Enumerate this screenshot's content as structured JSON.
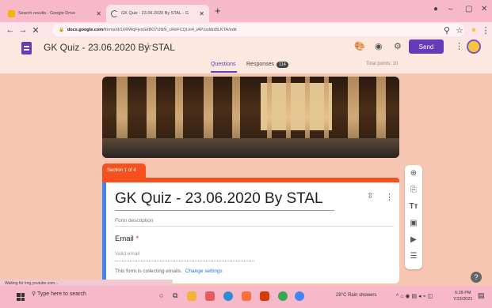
{
  "browser": {
    "tabs": [
      {
        "label": "Search results - Google Drive",
        "favicon_color": "#f4b400"
      },
      {
        "label": "GK Quiz - 23.06.2020 By STAL - G",
        "favicon_color": "#673ab7"
      }
    ],
    "new_tab": "+",
    "url_prefix": "docs.google.com",
    "url_rest": "/forms/d/1XRWqFjvxGkBO7UNN_cReFCQUo4_iAPzxddoBLKTA/edit"
  },
  "forms_header": {
    "doc_title": "GK Quiz - 23.06.2020 By STAL",
    "send_label": "Send",
    "tabs": {
      "questions": "Questions",
      "responses": "Responses",
      "responses_count": "114"
    },
    "total_points": "Total points: 10"
  },
  "section": {
    "label": "Section 1 of 4",
    "title": "GK Quiz - 23.06.2020 By STAL",
    "description_placeholder": "Form description",
    "email_label": "Email",
    "email_required_mark": "*",
    "email_placeholder": "Valid email",
    "collect_note": "This form is collecting emails.",
    "change_settings": "Change settings"
  },
  "status_text": "Waiting for img.youtube.com...",
  "taskbar": {
    "search_placeholder": "Type here to search",
    "weather": "28°C Rain showers",
    "time": "6:28 PM",
    "date": "7/23/2021"
  },
  "colors": {
    "accent": "#673ab7",
    "section": "#f4511e",
    "card_border": "#4285f4"
  }
}
